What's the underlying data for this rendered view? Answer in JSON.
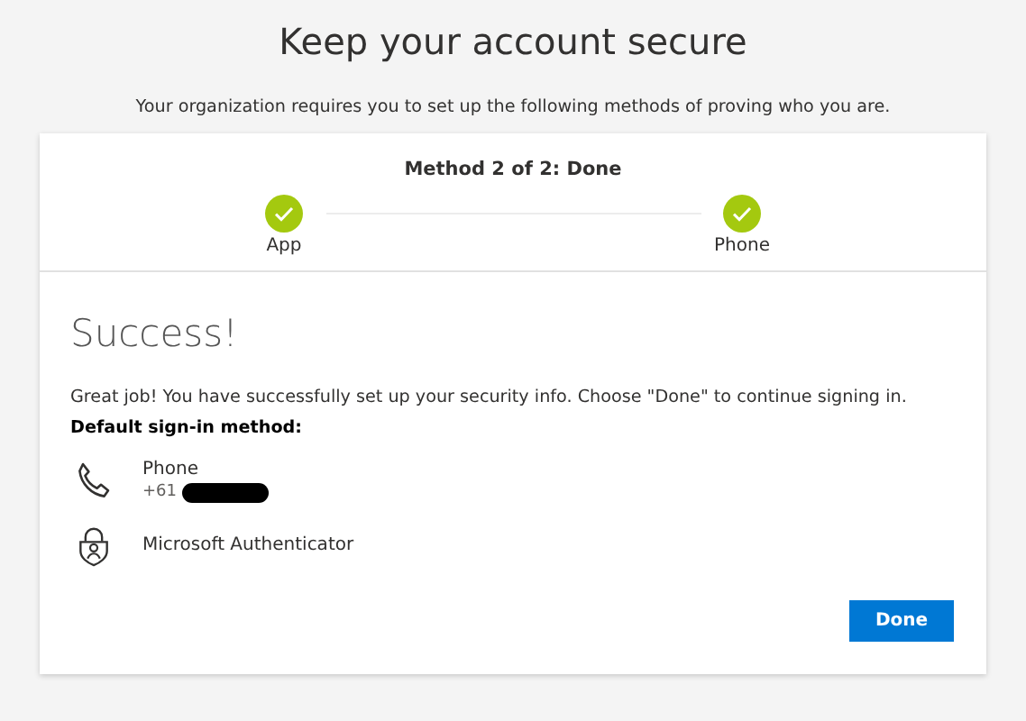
{
  "title": "Keep your account secure",
  "subtitle": "Your organization requires you to set up the following methods of proving who you are.",
  "progress": {
    "label": "Method 2 of 2: Done",
    "steps": [
      {
        "label": "App",
        "done": true
      },
      {
        "label": "Phone",
        "done": true
      }
    ]
  },
  "heading": "Success!",
  "message": "Great job! You have successfully set up your security info. Choose \"Done\" to continue signing in.",
  "default_label": "Default sign-in method:",
  "methods": [
    {
      "kind": "phone",
      "name": "Phone",
      "detail": "+61",
      "redacted": true
    },
    {
      "kind": "authenticator",
      "name": "Microsoft Authenticator"
    }
  ],
  "button": "Done"
}
